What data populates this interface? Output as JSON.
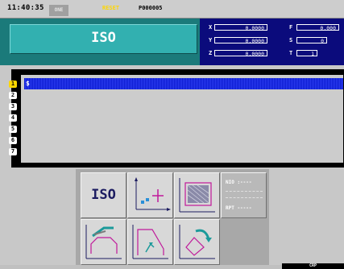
{
  "status": {
    "clock": "11:40:35",
    "mode": "ONE",
    "reset": "RESET",
    "program": "P000005"
  },
  "title": "ISO",
  "coords": {
    "x": {
      "label": "X",
      "value": "0.0000"
    },
    "y": {
      "label": "Y",
      "value": "0.0000"
    },
    "z": {
      "label": "Z",
      "value": "0.0000"
    },
    "f": {
      "label": "F",
      "value": "0.000"
    },
    "s": {
      "label": "S",
      "value": "0"
    },
    "t": {
      "label": "T",
      "value": "1"
    }
  },
  "line_numbers": [
    "1",
    "2",
    "3",
    "4",
    "5",
    "6",
    "7"
  ],
  "cursor_mark": "$",
  "menu": {
    "iso_label": "ISO",
    "info": {
      "line1": "NIO :----",
      "line2": "RPT -----"
    }
  },
  "bottom_label": "CRP",
  "colors": {
    "teal": "#1b7a7a",
    "coord_panel": "#0b0b7c",
    "cursor": "#0c1bd0",
    "reset": "#ffd700"
  }
}
